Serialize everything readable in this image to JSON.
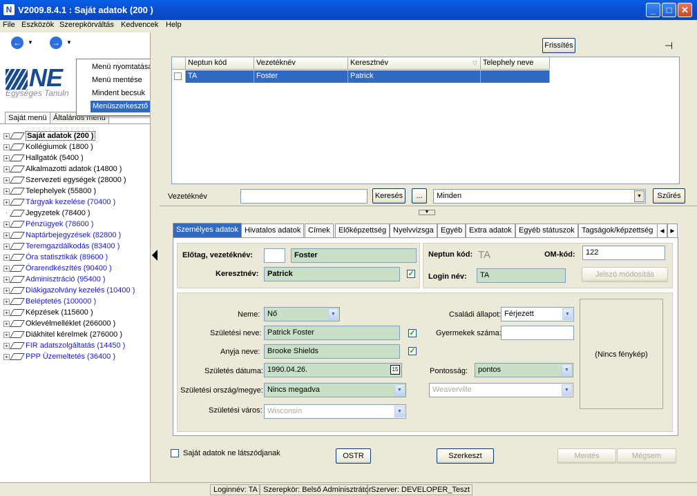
{
  "window": {
    "title": "V2009.8.4.1 : Saját adatok (200  )"
  },
  "menubar": [
    "File",
    "Eszközök",
    "Szerepkörváltás",
    "Kedvencek",
    "Help"
  ],
  "logo": {
    "text": "NE",
    "subtitle": "Egységes Tanuln"
  },
  "left_tabs": [
    "Saját menü",
    "Általános menü"
  ],
  "popup_menu": [
    "Menü nyomtatása",
    "Menü mentése",
    "Mindent becsuk",
    "Menüszerkesztő"
  ],
  "tree": [
    {
      "label": "Saját adatok (200  )",
      "selected": true,
      "blue": false
    },
    {
      "label": "Kollégiumok (1800  )",
      "blue": false
    },
    {
      "label": "Hallgatók (5400  )",
      "blue": false
    },
    {
      "label": "Alkalmazotti adatok (14800  )",
      "blue": false
    },
    {
      "label": "Szervezeti egységek (28000  )",
      "blue": false
    },
    {
      "label": "Telephelyek (55800  )",
      "blue": false
    },
    {
      "label": "Tárgyak kezelése (70400  )",
      "blue": true
    },
    {
      "label": "Jegyzetek (78400  )",
      "blue": false,
      "leaf": true
    },
    {
      "label": "Pénzügyek (78600  )",
      "blue": true
    },
    {
      "label": "Naptárbejegyzések (82800  )",
      "blue": true
    },
    {
      "label": "Teremgazdálkodás (83400  )",
      "blue": true
    },
    {
      "label": "Óra statisztikák (89600  )",
      "blue": true
    },
    {
      "label": "Órarendkészítés (90400  )",
      "blue": true
    },
    {
      "label": "Adminisztráció (95400  )",
      "blue": true
    },
    {
      "label": "Diákigazolvány kezelés (10400  )",
      "blue": true
    },
    {
      "label": "Beléptetés (100000  )",
      "blue": true
    },
    {
      "label": "Képzések (115600  )",
      "blue": false
    },
    {
      "label": "Oklevélmelléklet (266000  )",
      "blue": false
    },
    {
      "label": "Diákhitel kérelmek (276000  )",
      "blue": false
    },
    {
      "label": "FIR adatszolgáltatás (14450  )",
      "blue": true
    },
    {
      "label": "PPP Üzemeltetés (36400  )",
      "blue": true
    }
  ],
  "toolbar": {
    "refresh_label": "Frissítés"
  },
  "grid": {
    "columns": [
      "Neptun kód",
      "Vezetéknév",
      "Keresztnév",
      "Telephely neve"
    ],
    "rows": [
      [
        "TA",
        "Foster",
        "Patrick",
        ""
      ]
    ]
  },
  "search": {
    "label": "Vezetéknév",
    "value": "",
    "search_button": "Keresés",
    "ellipsis_button": "...",
    "filter_value": "Minden",
    "filter_button": "Szűrés"
  },
  "tabs": [
    "Személyes adatok",
    "Hivatalos adatok",
    "Címek",
    "Előképzettség",
    "Nyelvvizsga",
    "Egyéb",
    "Extra adatok",
    "Egyéb státuszok",
    "Tagságok/képzettség"
  ],
  "form": {
    "prefix_label": "Előtag, vezetéknév:",
    "prefix_value": "",
    "surname_value": "Foster",
    "firstname_label": "Keresztnév:",
    "firstname_value": "Patrick",
    "neptun_label": "Neptun kód:",
    "neptun_value": "TA",
    "om_label": "OM-kód:",
    "om_value": "122",
    "login_label": "Login név:",
    "login_value": "TA",
    "password_button": "Jelszó módosítás",
    "gender_label": "Neme:",
    "gender_value": "Nő",
    "birthname_label": "Születési neve:",
    "birthname_value": "Patrick Foster",
    "mother_label": "Anyja neve:",
    "mother_value": "Brooke Shields",
    "birthdate_label": "Születés dátuma:",
    "birthdate_value": "1990.04.26.",
    "calendar_day": "15",
    "birthcountry_label": "Születési ország/megye:",
    "birthcountry_value": "Nincs megadva",
    "birthcity_label": "Születési város:",
    "birthcity_value": "Wisconsin",
    "marital_label": "Családi állapot:",
    "marital_value": "Férjezett",
    "children_label": "Gyermekek száma:",
    "children_value": "",
    "accuracy_label": "Pontosság:",
    "accuracy_value": "pontos",
    "city2_value": "Weaverville",
    "photo_text": "(Nincs fénykép)"
  },
  "bottom": {
    "hide_label": "Saját adatok ne látszódjanak",
    "ostr": "OSTR",
    "szerkeszt": "Szerkeszt",
    "save": "Mentés",
    "cancel": "Mégsem"
  },
  "status": {
    "login": "Loginnév: TA",
    "role": "Szerepkör: Belső Adminisztrátor",
    "server": "Szerver: DEVELOPER_Teszt"
  }
}
